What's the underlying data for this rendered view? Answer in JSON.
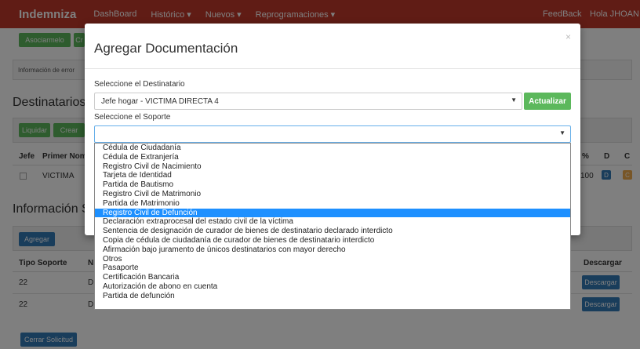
{
  "navbar": {
    "brand": "Indemniza",
    "links": [
      "DashBoard",
      "Histórico ▾",
      "Nuevos ▾",
      "Reprogramaciones ▾"
    ],
    "feedback": "FeedBack",
    "greeting": "Hola JHOAN"
  },
  "background": {
    "top_buttons": [
      "Asociarmelo",
      "Cr"
    ],
    "info_text": "Información de error",
    "destinatarios_title": "Destinatarios",
    "table_buttons": [
      "Liquidar",
      "Crear"
    ],
    "table_headers": [
      "Jefe",
      "Primer Nom",
      "%",
      "D",
      "C"
    ],
    "table_row": {
      "name": "VICTIMA",
      "percent": "100",
      "d": "D",
      "c": "C"
    },
    "info_section_title": "Información S",
    "add_button": "Agregar",
    "doc_headers": [
      "Tipo Soporte",
      "N",
      "Descargar"
    ],
    "doc_rows": [
      {
        "tipo": "22",
        "n": "D",
        "download": "Descargar"
      },
      {
        "tipo": "22",
        "n": "D",
        "download": "Descargar"
      }
    ],
    "close_request_button": "Cerrar Solicitud"
  },
  "modal": {
    "title": "Agregar Documentación",
    "close": "×",
    "destinatario_label": "Seleccione el Destinatario",
    "destinatario_value": "Jefe hogar - VICTIMA DIRECTA 4",
    "update_button": "Actualizar",
    "soporte_label": "Seleccione el Soporte",
    "soporte_value": "",
    "soporte_options": [
      "Cédula de Ciudadanía",
      "Cédula de Extranjería",
      "Registro Civil de Nacimiento",
      "Tarjeta de Identidad",
      "Partida de Bautismo",
      "Registro Civil de Matrimonio",
      "Partida de Matrimonio",
      "Registro Civil de Defunción",
      "Declaración extraprocesal del estado civil de la víctima",
      "Sentencia de designación de curador de bienes de destinatario declarado interdicto",
      "Copia de cédula de ciudadanía de curador de bienes de destinatario interdicto",
      "Afirmación bajo juramento de únicos destinatarios con mayor derecho",
      "Otros",
      "Pasaporte",
      "Certificación Bancaria",
      "Autorización de abono en cuenta",
      "Partida de defunción"
    ],
    "highlighted_option": "Registro Civil de Defunción"
  },
  "colors": {
    "navbar": "#c0392b",
    "success": "#5cb85c",
    "primary": "#337ab7",
    "highlight": "#1e90ff"
  }
}
